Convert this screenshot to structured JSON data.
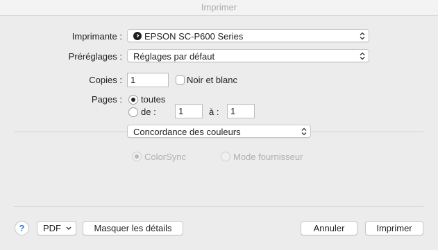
{
  "window": {
    "title": "Imprimer"
  },
  "printer": {
    "label": "Imprimante :",
    "value": "EPSON SC-P600 Series"
  },
  "presets": {
    "label": "Préréglages :",
    "value": "Réglages par défaut"
  },
  "copies": {
    "label": "Copies :",
    "value": "1",
    "bw_label": "Noir et blanc",
    "bw_checked": false
  },
  "pages": {
    "label": "Pages :",
    "all_label": "toutes",
    "range_label": "de :",
    "from_value": "1",
    "to_label": "à :",
    "to_value": "1",
    "selected": "all"
  },
  "section": {
    "value": "Concordance des couleurs"
  },
  "color_matching": {
    "option1": "ColorSync",
    "option2": "Mode fournisseur",
    "selected": "ColorSync",
    "enabled": false
  },
  "footer": {
    "help_label": "?",
    "pdf_label": "PDF",
    "details_label": "Masquer les détails",
    "cancel_label": "Annuler",
    "print_label": "Imprimer"
  }
}
